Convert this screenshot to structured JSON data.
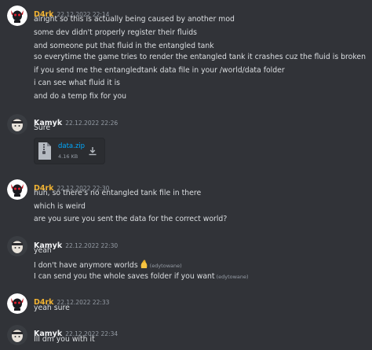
{
  "colors": {
    "background": "#313338",
    "d4rk_name": "#f0b232",
    "kamyk_name": "#f2f3f5",
    "text": "#dbdee1",
    "timestamp": "#949ba4",
    "link": "#00a8fc"
  },
  "messages": [
    {
      "author": "D4rk",
      "timestamp": "22.12.2022 22:14",
      "avatar_icon": "skull-horns-avatar-icon",
      "lines": [
        "alright so this is actually being caused by another mod",
        "some dev didn't properly register their fluids",
        "and someone put that fluid in the entangled tank",
        "so everytime the game tries to render the entangled tank it crashes cuz the fluid is broken",
        "if you send me the entangledtank data file in your /world/data folder",
        "i can see what fluid it is",
        "and do a temp fix for you"
      ]
    },
    {
      "author": "Kamyk",
      "timestamp": "22.12.2022 22:26",
      "avatar_icon": "character-avatar-icon",
      "lines": [
        "Sure"
      ],
      "attachment": {
        "file_name": "data.zip",
        "file_size": "4.16 KB",
        "file_icon": "zip-file-icon",
        "download_icon": "download-icon"
      }
    },
    {
      "author": "D4rk",
      "timestamp": "22.12.2022 22:30",
      "avatar_icon": "skull-horns-avatar-icon",
      "lines": [
        "huh, so there's no entangled tank file in there",
        "which is weird",
        "are you sure you sent the data for the correct world?"
      ]
    },
    {
      "author": "Kamyk",
      "timestamp": "22.12.2022 22:30",
      "avatar_icon": "character-avatar-icon",
      "lines": [
        "yeah",
        "I don't have anymore worlds",
        "I can send you the whole saves folder if you want"
      ],
      "edited_label": "(edytowane)",
      "emoji_icon": "pinched-fingers-emoji-icon"
    },
    {
      "author": "D4rk",
      "timestamp": "22.12.2022 22:33",
      "avatar_icon": "skull-horns-avatar-icon",
      "lines": [
        "yeah sure"
      ]
    },
    {
      "author": "Kamyk",
      "timestamp": "22.12.2022 22:34",
      "avatar_icon": "character-avatar-icon",
      "lines": [
        "Ill dm you with it"
      ]
    }
  ]
}
